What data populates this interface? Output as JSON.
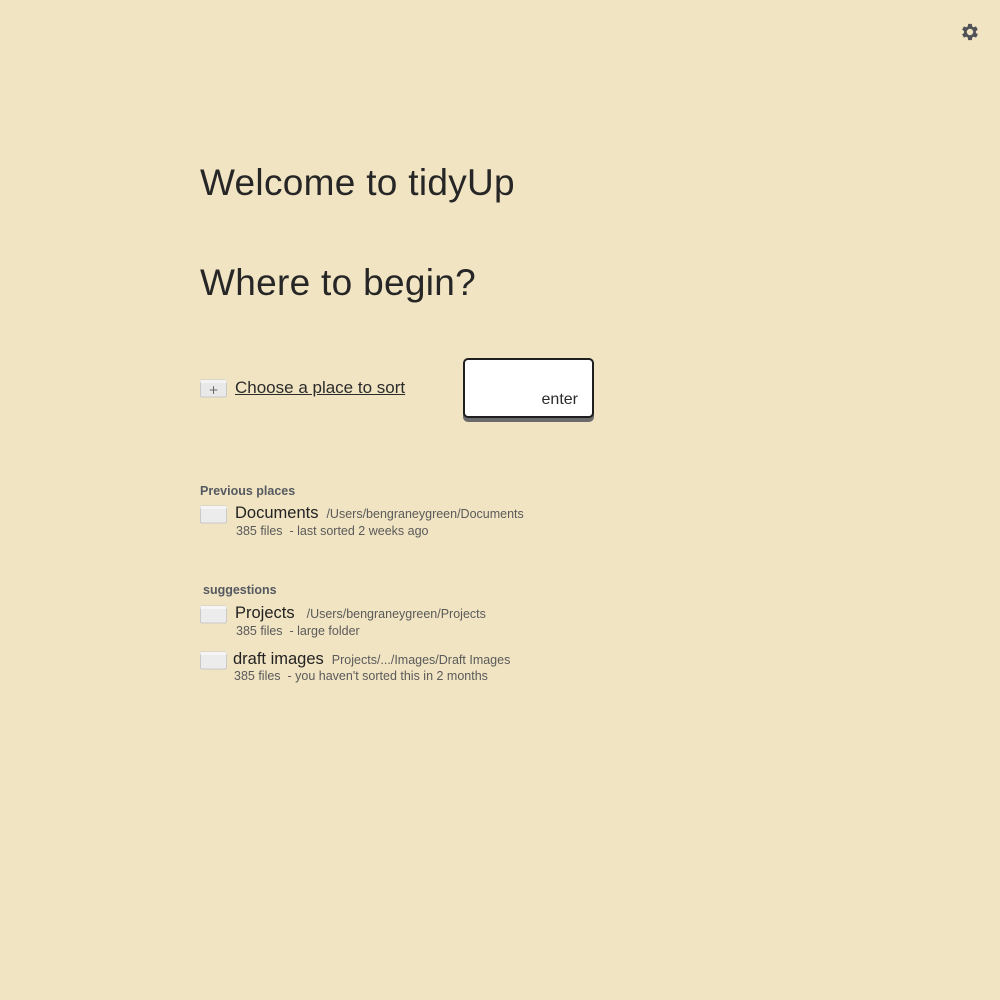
{
  "header": {
    "welcome": "Welcome to tidyUp",
    "prompt": "Where to begin?"
  },
  "settings": {
    "icon": "gear-icon"
  },
  "choose": {
    "label": "Choose a place to sort",
    "icon": "folder-plus-icon",
    "enter_label": "enter"
  },
  "previous": {
    "heading": "Previous places",
    "items": [
      {
        "name": "Documents",
        "path": "/Users/bengraneygreen/Documents",
        "count": "385 files",
        "note": "- last sorted 2 weeks ago"
      }
    ]
  },
  "suggestions": {
    "heading": "suggestions",
    "items": [
      {
        "name": "Projects",
        "path": "/Users/bengraneygreen/Projects",
        "count": "385 files",
        "note": "- large folder"
      },
      {
        "name": "draft images",
        "path": "Projects/.../Images/Draft Images",
        "count": "385 files",
        "note": "- you haven't sorted this in 2 months"
      }
    ]
  },
  "colors": {
    "background": "#f1e4c3",
    "text": "#262626",
    "muted": "#5a5a5a"
  }
}
